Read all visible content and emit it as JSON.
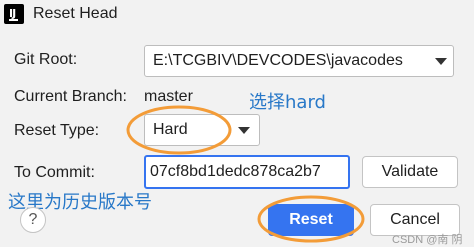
{
  "window": {
    "title": "Reset Head"
  },
  "form": {
    "git_root_label": "Git Root:",
    "git_root_value": "E:\\TCGBIV\\DEVCODES\\javacodes",
    "branch_label": "Current Branch:",
    "branch_value": "master",
    "reset_type_label": "Reset Type:",
    "reset_type_value": "Hard",
    "commit_label": "To Commit:",
    "commit_value": "07cf8bd1dedc878ca2b7"
  },
  "buttons": {
    "validate": "Validate",
    "reset": "Reset",
    "cancel": "Cancel",
    "help": "?"
  },
  "annotations": {
    "select_hard": "选择hard",
    "history_version": "这里为历史版本号"
  },
  "footer": {
    "watermark": "CSDN @南 阴"
  },
  "colors": {
    "accent": "#3574f0",
    "annotation": "#2878c8",
    "highlight_ring": "#f39c38"
  }
}
